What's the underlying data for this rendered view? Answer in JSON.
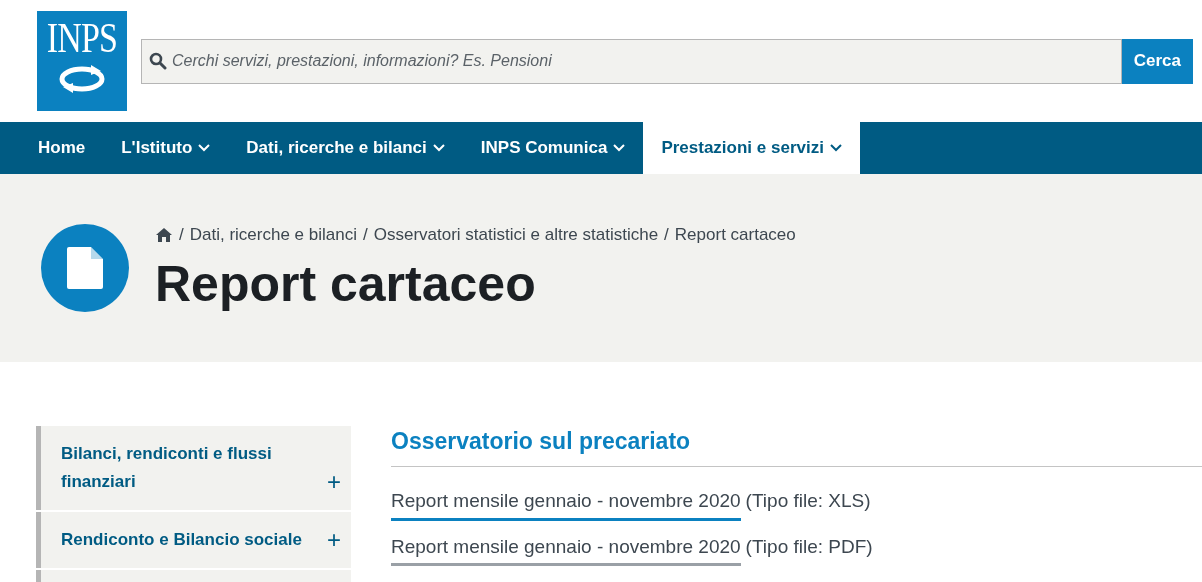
{
  "logo": {
    "text": "INPS"
  },
  "search": {
    "placeholder": "Cerchi servizi, prestazioni, informazioni? Es. Pensioni",
    "button": "Cerca"
  },
  "nav": [
    {
      "label": "Home",
      "dropdown": false,
      "selected": false
    },
    {
      "label": "L'Istituto",
      "dropdown": true,
      "selected": false
    },
    {
      "label": "Dati, ricerche e bilanci",
      "dropdown": true,
      "selected": false
    },
    {
      "label": "INPS Comunica",
      "dropdown": true,
      "selected": false
    },
    {
      "label": "Prestazioni e servizi",
      "dropdown": true,
      "selected": true
    }
  ],
  "breadcrumb": [
    {
      "separator": "/",
      "label": "Dati, ricerche e bilanci"
    },
    {
      "separator": "/",
      "label": "Osservatori statistici e altre statistiche"
    },
    {
      "separator": "/",
      "label": "Report cartaceo"
    }
  ],
  "page_title": "Report cartaceo",
  "sidebar": [
    {
      "label": "Bilanci, rendiconti e flussi finanziari",
      "expand": "+"
    },
    {
      "label": "Rendiconto e Bilancio sociale",
      "expand": "+"
    }
  ],
  "section": {
    "title": "Osservatorio sul precariato",
    "links": [
      {
        "label": "Report mensile gennaio - novembre 2020",
        "note": "(Tipo file: XLS)",
        "highlighted": true
      },
      {
        "label": "Report mensile gennaio - novembre 2020",
        "note": "(Tipo file: PDF)",
        "highlighted": false
      }
    ]
  }
}
